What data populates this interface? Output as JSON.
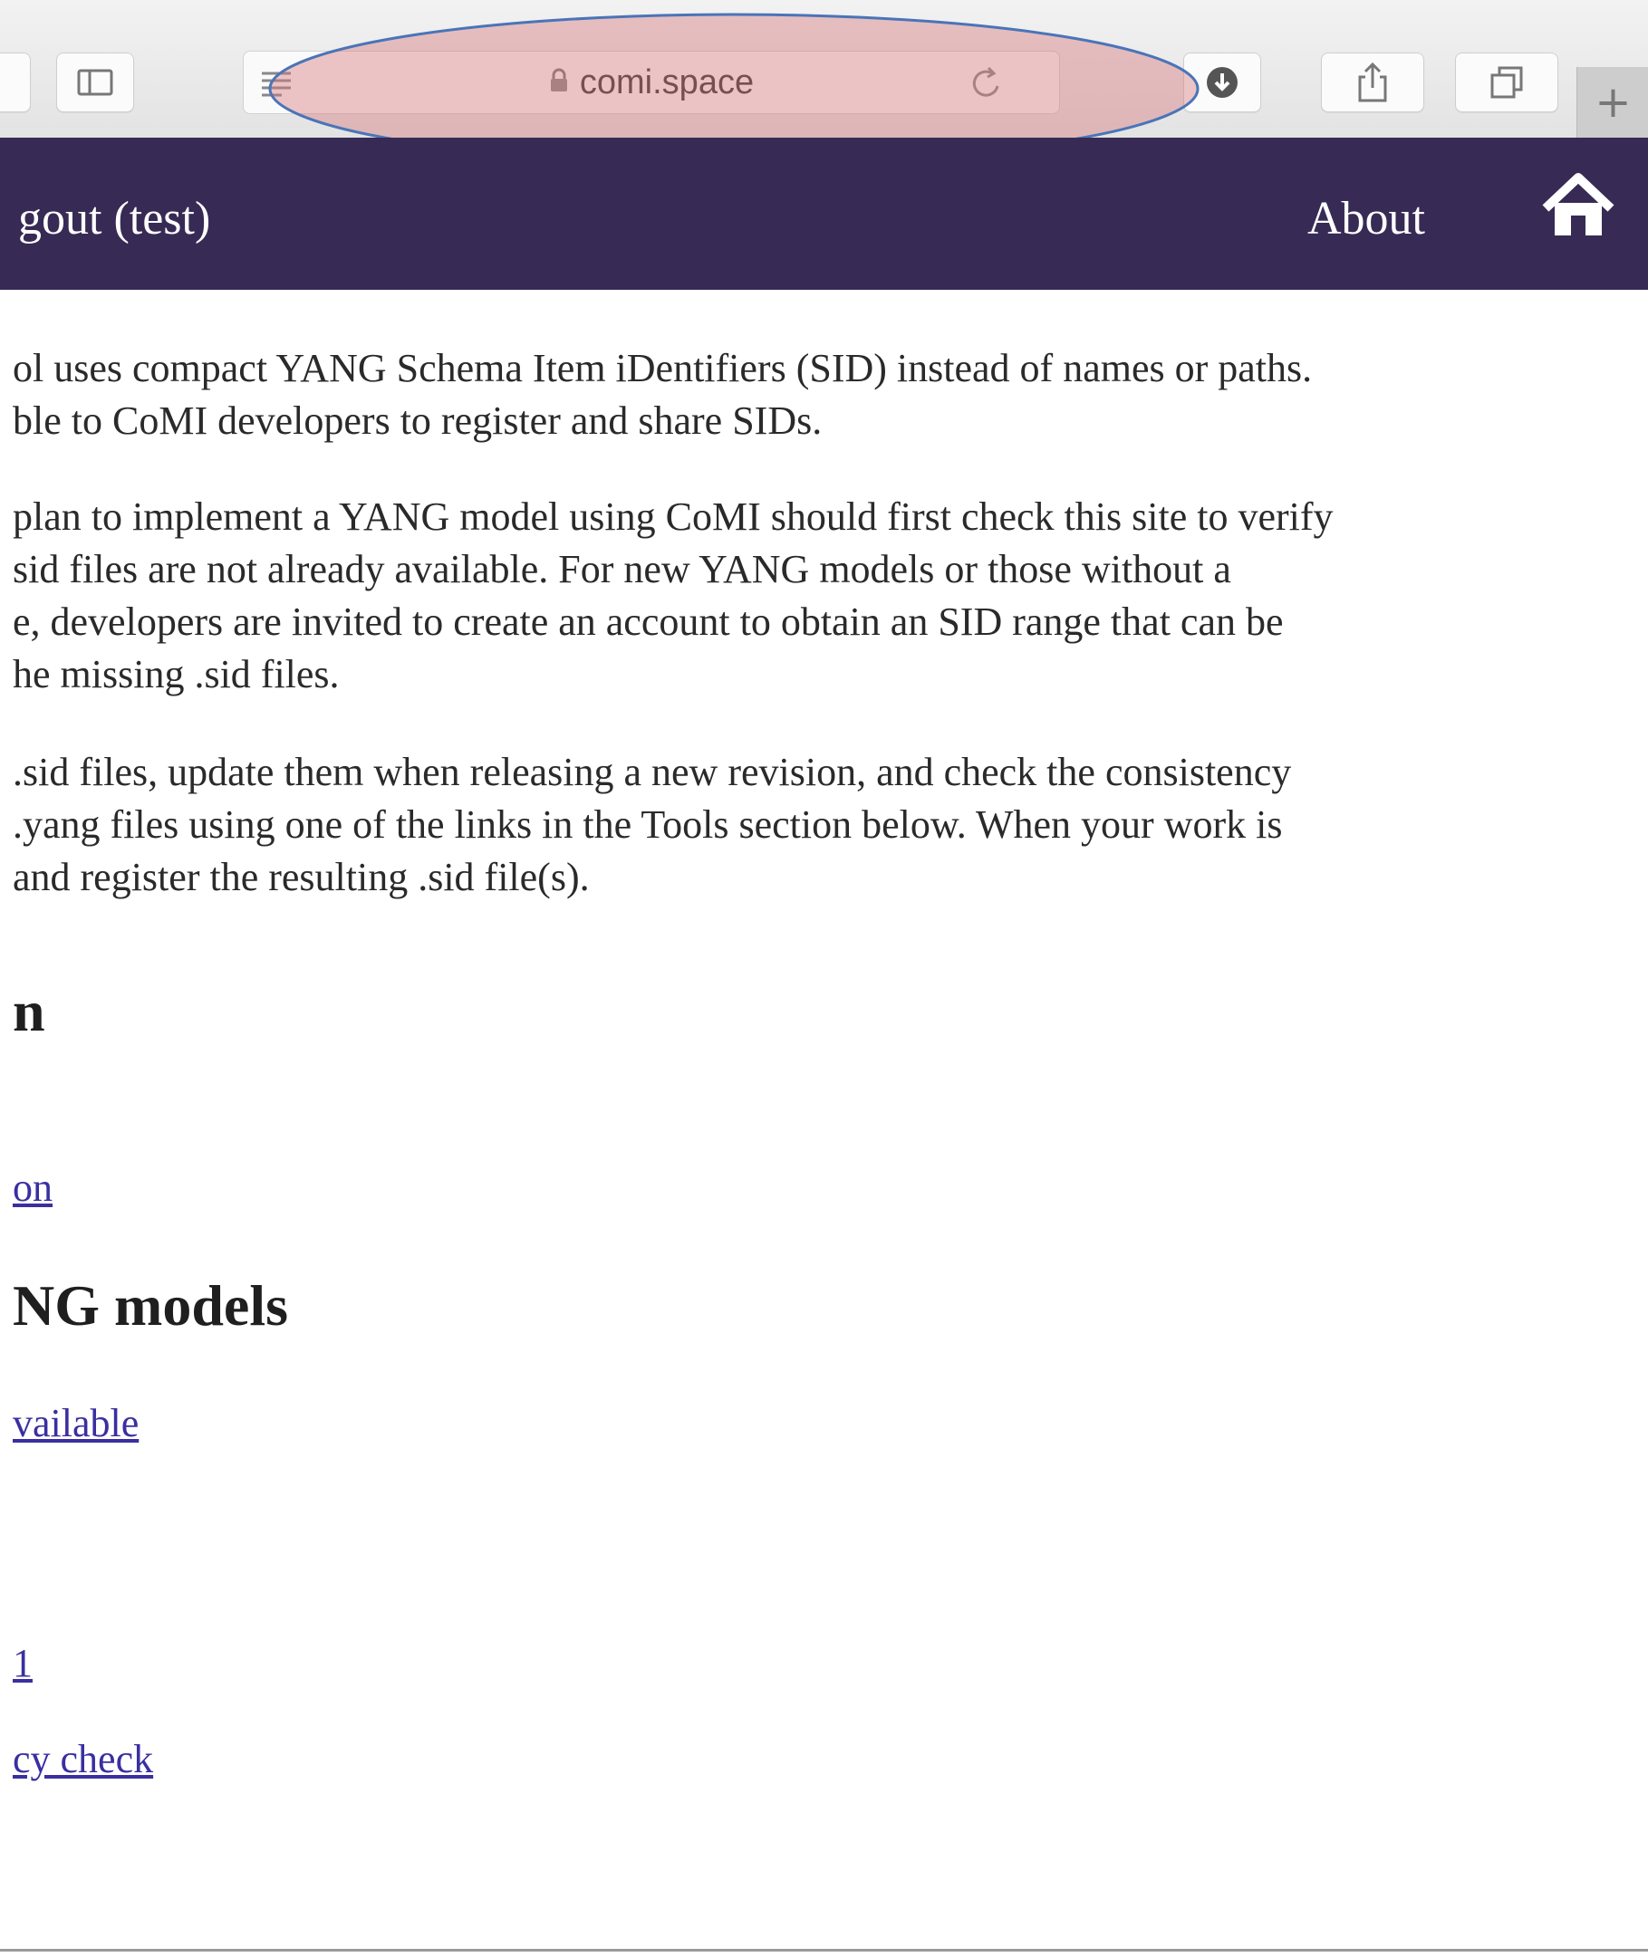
{
  "browser": {
    "address": "comi.space",
    "new_tab_symbol": "+",
    "icons": [
      "sidebar-icon",
      "reader-icon",
      "lock-icon",
      "reload-icon",
      "download-icon",
      "share-icon",
      "tabs-icon"
    ],
    "highlight_color": "#e8b4b8"
  },
  "nav": {
    "logout_label": "gout (test)",
    "about_label": "About",
    "home_icon": "home-icon",
    "background": "#372b55"
  },
  "content": {
    "paragraphs": [
      [
        "ol uses compact YANG Schema Item iDentifiers (SID) instead of names or paths.",
        "ble to CoMI developers to register and share SIDs."
      ],
      [
        "plan to implement a YANG model using CoMI should first check this site to verify",
        "sid files are not already available. For new YANG models or those without a",
        "e, developers are invited to create an account to obtain an SID range that can be",
        "he missing .sid files."
      ],
      [
        ".sid files, update them when releasing a new revision, and check the consistency",
        ".yang files using one of the links in the Tools section below. When your work is",
        " and register the resulting .sid file(s)."
      ]
    ],
    "section1_heading": "n",
    "section1_link": "on",
    "section2_heading": "NG models",
    "section2_link1": "vailable",
    "section2_link2": "1",
    "section2_link3": "cy check",
    "link_color": "#3a2fa0"
  }
}
